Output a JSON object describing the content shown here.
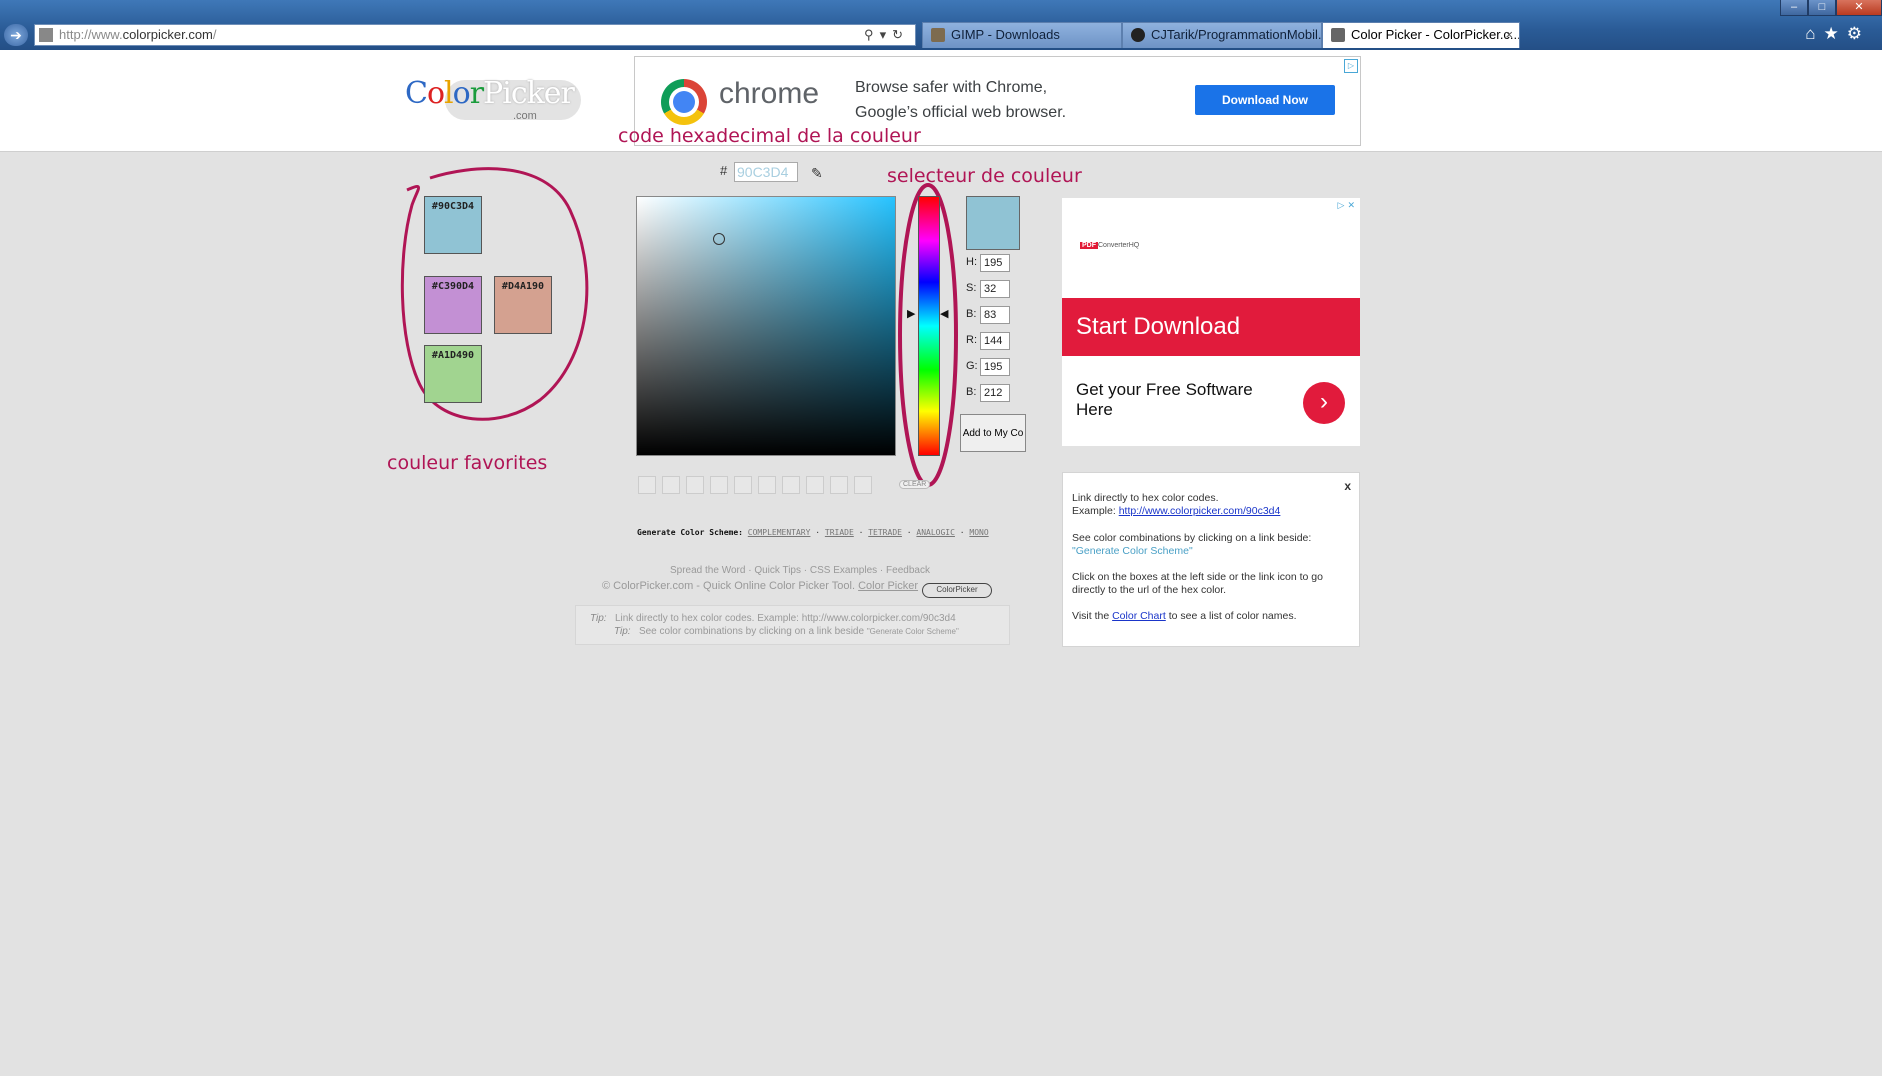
{
  "browser": {
    "back_icon": "back-arrow-icon",
    "url_prefix": "http://www.",
    "url_host": "colorpicker.com",
    "url_suffix": "/",
    "tabs": [
      {
        "label": "GIMP - Downloads",
        "icon": "gimp-icon"
      },
      {
        "label": "CJTarik/ProgrammationMobil...",
        "icon": "github-icon"
      },
      {
        "label": "Color Picker - ColorPicker.c...",
        "icon": "colorpicker-icon"
      }
    ],
    "close_tab": "×"
  },
  "logo": {
    "text": "ColorPicker",
    "suffix": ".com"
  },
  "top_ad": {
    "brand": "chrome",
    "line1": "Browse safer with Chrome,",
    "line2": "Google’s official web browser.",
    "button": "Download Now"
  },
  "annotations": {
    "hex_code": "code hexadecimal de la couleur",
    "selector": "selecteur de couleur",
    "favorites": "couleur favorites"
  },
  "favorites": [
    {
      "label": "#90C3D4",
      "color": "#90C3D4"
    },
    {
      "label": "#C390D4",
      "color": "#C390D4"
    },
    {
      "label": "#D4A190",
      "color": "#D4A190"
    },
    {
      "label": "#A1D490",
      "color": "#A1D490"
    }
  ],
  "picker": {
    "hash": "#",
    "hex_value": "90C3D4",
    "fields": [
      {
        "label": "H:",
        "value": "195"
      },
      {
        "label": "S:",
        "value": "32"
      },
      {
        "label": "B:",
        "value": "83"
      },
      {
        "label": "R:",
        "value": "144"
      },
      {
        "label": "G:",
        "value": "195"
      },
      {
        "label": "B:",
        "value": "212"
      }
    ],
    "add_button": "Add to My Co",
    "clear": "CLEAR",
    "current_color": "#90C3D4"
  },
  "scheme": {
    "label": "Generate Color Scheme:",
    "links": [
      "COMPLEMENTARY",
      "TRIADE",
      "TETRADE",
      "ANALOGIC",
      "MONO"
    ]
  },
  "footer": {
    "links": [
      "Spread the Word",
      "Quick Tips",
      "CSS Examples",
      "Feedback"
    ],
    "copyright": "© ColorPicker.com - Quick Online Color Picker Tool.",
    "copyright_link": "Color Picker",
    "badge": "ColorPicker"
  },
  "tips": {
    "label": "Tip:",
    "tip1": "Link directly to hex color codes.   Example: http://www.colorpicker.com/90c3d4",
    "tip2": "See color combinations by clicking on a link beside",
    "tip2_small": "\"Generate Color Scheme\""
  },
  "side_ad": {
    "sponsor_tag": "PDF",
    "sponsor": "ConverterHQ",
    "banner": "Start Download",
    "sub": "Get your Free Software Here"
  },
  "info": {
    "close": "x",
    "l1": "Link directly to hex color codes.",
    "l2_prefix": "Example:",
    "l2_link": "http://www.colorpicker.com/90c3d4",
    "l3": "See color combinations by clicking on a link beside:",
    "l4": "\"Generate Color Scheme\"",
    "l5": "Click on the boxes at the left side or the link icon to go",
    "l6": "directly to the url of the hex color.",
    "l7_prefix": "Visit the",
    "l7_link": "Color Chart",
    "l7_suffix": "to see a list of color names."
  }
}
